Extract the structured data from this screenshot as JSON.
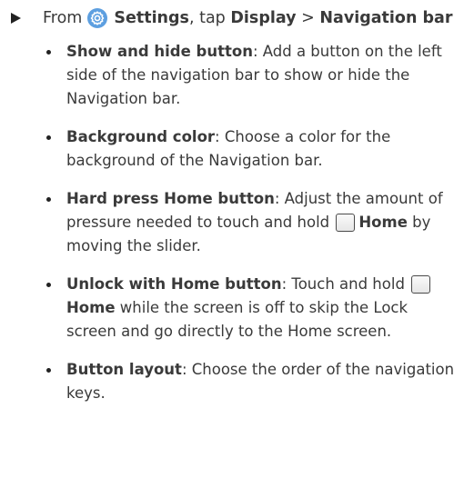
{
  "lead": {
    "prefix": "From",
    "settings_label": "Settings",
    "middle": ", tap",
    "display_label": "Display",
    "separator": ">",
    "navbar_label": "Navigation bar"
  },
  "items": [
    {
      "term": "Show and hide button",
      "text": ": Add a button on the left side of the navigation bar to show or hide the Navigation bar."
    },
    {
      "term": "Background color",
      "text": ": Choose a color for the background of the Navigation bar."
    },
    {
      "term": "Hard press Home button",
      "text_1": ": Adjust the amount of pressure needed to touch and hold",
      "home_label": "Home",
      "text_2": "by moving the slider."
    },
    {
      "term": "Unlock with Home button",
      "text_1": ": Touch and hold",
      "home_label": "Home",
      "text_2": "while the screen is off to skip the Lock screen and go directly to the Home screen."
    },
    {
      "term": "Button layout",
      "text": ": Choose the order of the navigation keys."
    }
  ],
  "icons": {
    "lead_arrow": "triangle-right-icon",
    "settings": "gear-icon",
    "home": "home-button-icon"
  },
  "colors": {
    "text": "#3a3a3a",
    "settings_icon": "#5d9fe0"
  }
}
